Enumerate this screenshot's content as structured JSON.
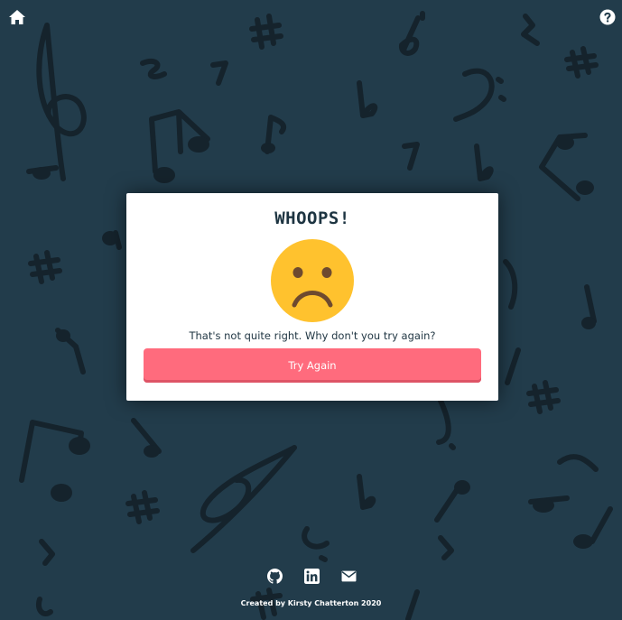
{
  "nav": {
    "home_icon": "home-icon",
    "help_icon": "question-circle-icon"
  },
  "modal": {
    "title": "WHOOPS!",
    "face_icon": "sad-face-emoji",
    "message": "That's not quite right. Why don't you try again?",
    "button_label": "Try Again"
  },
  "footer": {
    "icons": [
      "github-icon",
      "linkedin-icon",
      "envelope-icon"
    ],
    "credit": "Created by Kirsty Chatterton 2020"
  },
  "colors": {
    "background": "#223c4b",
    "pattern": "#15232c",
    "modal_background": "#ffffff",
    "button": "#ff6b7d",
    "title_text": "#1d3441",
    "emoji_face": "#ffc22e",
    "emoji_features": "#6e4a2f"
  }
}
